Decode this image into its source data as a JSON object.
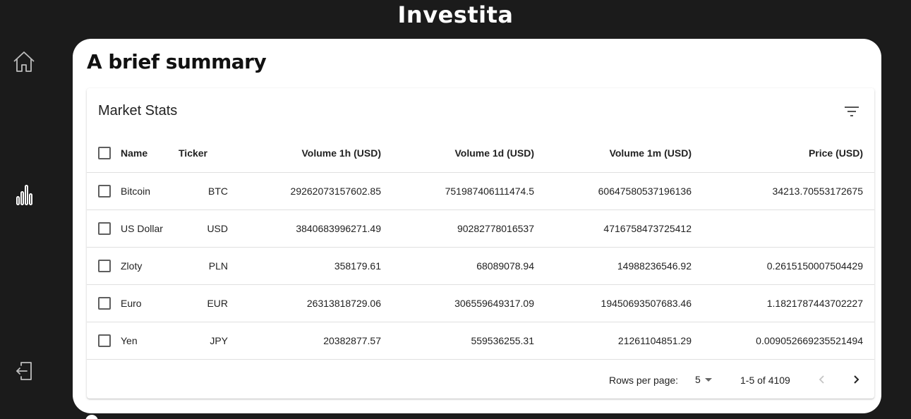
{
  "app": {
    "title": "Investita"
  },
  "sidebar": {
    "items": [
      {
        "name": "home",
        "icon": "home-icon"
      },
      {
        "name": "stats",
        "icon": "bar-chart-icon"
      },
      {
        "name": "logout",
        "icon": "logout-icon"
      }
    ]
  },
  "main": {
    "title": "A brief summary",
    "market_stats": {
      "title": "Market Stats",
      "filter_icon": "filter-list-icon",
      "columns": [
        "Name",
        "Ticker",
        "Volume 1h (USD)",
        "Volume 1d (USD)",
        "Volume 1m (USD)",
        "Price (USD)"
      ],
      "rows": [
        {
          "name": "Bitcoin",
          "ticker": "BTC",
          "vol1h": "29262073157602.85",
          "vol1d": "751987406111474.5",
          "vol1m": "60647580537196136",
          "price": "34213.70553172675"
        },
        {
          "name": "US Dollar",
          "ticker": "USD",
          "vol1h": "3840683996271.49",
          "vol1d": "90282778016537",
          "vol1m": "4716758473725412",
          "price": ""
        },
        {
          "name": "Zloty",
          "ticker": "PLN",
          "vol1h": "358179.61",
          "vol1d": "68089078.94",
          "vol1m": "14988236546.92",
          "price": "0.2615150007504429"
        },
        {
          "name": "Euro",
          "ticker": "EUR",
          "vol1h": "26313818729.06",
          "vol1d": "306559649317.09",
          "vol1m": "19450693507683.46",
          "price": "1.1821787443702227"
        },
        {
          "name": "Yen",
          "ticker": "JPY",
          "vol1h": "20382877.57",
          "vol1d": "559536255.31",
          "vol1m": "21261104851.29",
          "price": "0.009052669235521494"
        }
      ],
      "pagination": {
        "rows_per_page_label": "Rows per page:",
        "rows_per_page": "5",
        "range": "1-5 of 4109"
      }
    }
  },
  "colors": {
    "background": "#1b1b1b",
    "card": "#ffffff",
    "text": "#222222"
  }
}
